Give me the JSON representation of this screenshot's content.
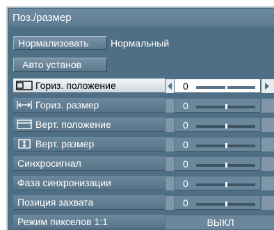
{
  "title": "Поз./размер",
  "normalize": {
    "button_label": "Нормализовать",
    "status_text": "Нормальный"
  },
  "auto_setup": {
    "button_label": "Авто установ"
  },
  "settings": [
    {
      "label": "Гориз. положение",
      "icon": "horizontal-position-icon",
      "value": "0",
      "level": 0.5,
      "selected": true
    },
    {
      "label": "Гориз. размер",
      "icon": "horizontal-size-icon",
      "value": "0",
      "level": 0.5,
      "selected": false
    },
    {
      "label": "Верт. положение",
      "icon": "vertical-position-icon",
      "value": "0",
      "level": 0.5,
      "selected": false
    },
    {
      "label": "Верт. размер",
      "icon": "vertical-size-icon",
      "value": "0",
      "level": 0.5,
      "selected": false
    },
    {
      "label": "Синхросигнал",
      "icon": "",
      "value": "0",
      "level": 0.5,
      "selected": false
    },
    {
      "label": "Фаза синхронизации",
      "icon": "",
      "value": "0",
      "level": 0.5,
      "selected": false
    },
    {
      "label": "Позиция захвата",
      "icon": "",
      "value": "0",
      "level": 0.5,
      "selected": false
    }
  ],
  "pixel_mode": {
    "label": "Режим пикселов 1:1",
    "value": "ВЫКЛ"
  },
  "colors": {
    "panel_background": "#4f6f86",
    "selected_row": "#e8ecef",
    "text": "#ffffff"
  }
}
